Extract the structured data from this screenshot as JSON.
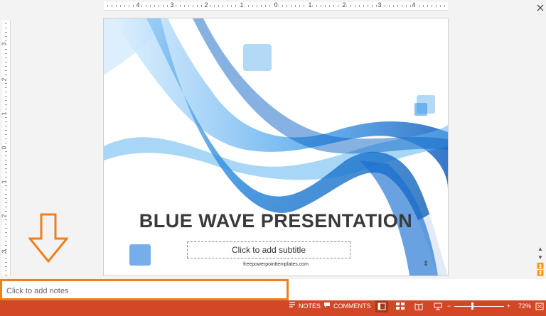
{
  "ruler": {
    "horizontal": [
      "4",
      "3",
      "2",
      "1",
      "0",
      "1",
      "2",
      "3",
      "4"
    ],
    "vertical": [
      "3",
      "2",
      "1",
      "0",
      "1",
      "2",
      "3"
    ]
  },
  "slide": {
    "title": "BLUE WAVE PRESENTATION",
    "subtitle_placeholder": "Click to add subtitle",
    "footer_url": "freepowerpointtemplates.com",
    "accent_color": "#1e7fd8"
  },
  "notes": {
    "placeholder": "Click to add notes",
    "highlight_color": "#f07f1b"
  },
  "statusbar": {
    "color": "#d24726",
    "notes_label": "NOTES",
    "comments_label": "COMMENTS",
    "zoom_minus": "−",
    "zoom_plus": "+",
    "zoom_level": "72%",
    "zoom_fraction": 0.72
  },
  "icons": [
    "close-icon",
    "scroll-up-icon",
    "scroll-down-icon",
    "prev-slide-icon",
    "next-slide-icon",
    "notes-icon",
    "comments-icon",
    "normal-view-icon",
    "slide-sorter-icon",
    "reading-view-icon",
    "slideshow-icon",
    "fit-window-icon",
    "down-arrow-icon"
  ]
}
